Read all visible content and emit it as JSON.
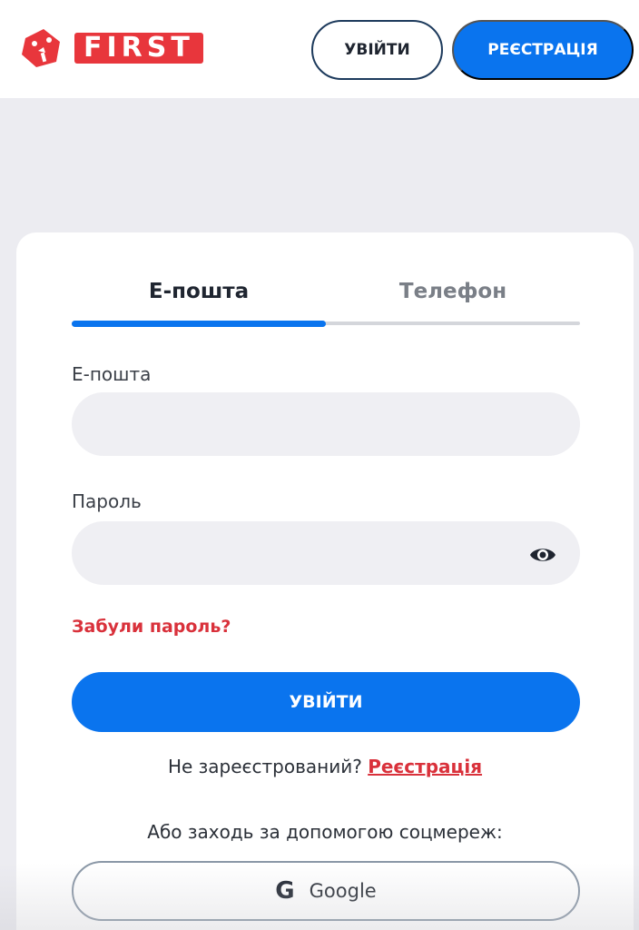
{
  "header": {
    "logo_text": "FIRST",
    "login_label": "УВІЙТИ",
    "register_label": "РЕЄСТРАЦІЯ"
  },
  "tabs": [
    {
      "label": "Е-пошта",
      "active": true
    },
    {
      "label": "Телефон",
      "active": false
    }
  ],
  "form": {
    "email_label": "Е-пошта",
    "email_value": "",
    "password_label": "Пароль",
    "password_value": "",
    "forgot_label": "Забули пароль?",
    "submit_label": "УВІЙТИ"
  },
  "register_prompt": {
    "text": "Не зареєстрований? ",
    "link": "Реєстрація"
  },
  "social": {
    "caption": "Або заходь за допомогою соцмереж:",
    "google_label": "Google",
    "google_icon": "G"
  },
  "colors": {
    "brand_red": "#e8363c",
    "accent_blue": "#0a74ee",
    "link_red": "#d9313b"
  },
  "icons": {
    "logo": "dice-icon",
    "password_toggle": "eye-icon",
    "google": "google-icon"
  }
}
